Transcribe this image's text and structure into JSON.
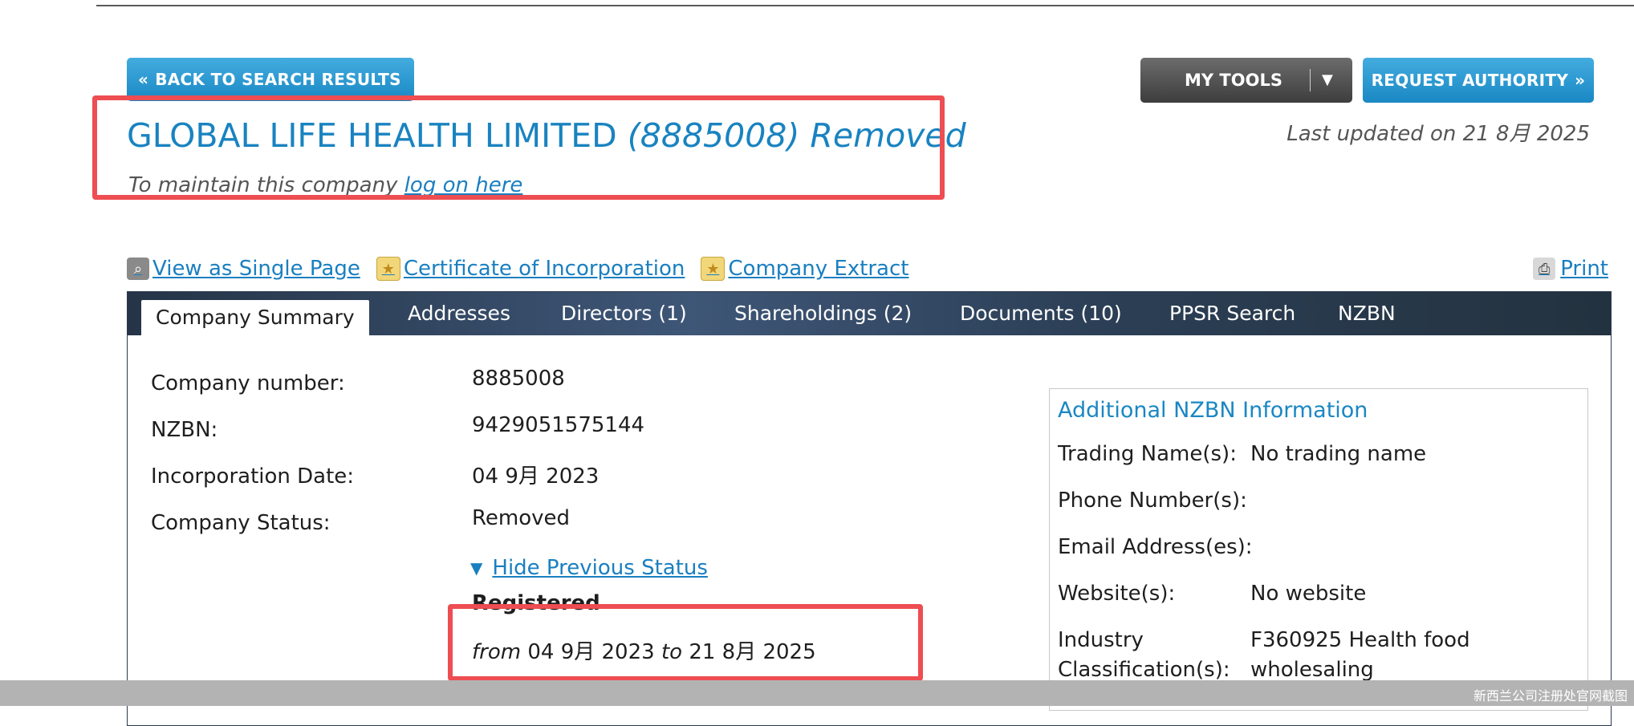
{
  "header": {
    "back_button": "BACK TO SEARCH RESULTS",
    "my_tools_button": "MY TOOLS",
    "request_authority_button": "REQUEST AUTHORITY",
    "last_updated": "Last updated on 21 8月 2025"
  },
  "company": {
    "name": "GLOBAL LIFE HEALTH LIMITED",
    "number_status": "(8885008) Removed",
    "maintain_text": "To maintain this company",
    "maintain_link": "log on here"
  },
  "tools": {
    "single_page": "View as Single Page",
    "certificate": "Certificate of Incorporation",
    "extract": "Company Extract",
    "print": "Print"
  },
  "tabs": [
    {
      "label": "Company Summary"
    },
    {
      "label": "Addresses"
    },
    {
      "label": "Directors (1)"
    },
    {
      "label": "Shareholdings (2)"
    },
    {
      "label": "Documents (10)"
    },
    {
      "label": "PPSR Search"
    },
    {
      "label": "NZBN"
    }
  ],
  "summary": {
    "company_number_label": "Company number:",
    "company_number": "8885008",
    "nzbn_label": "NZBN:",
    "nzbn": "9429051575144",
    "incorporation_label": "Incorporation Date:",
    "incorporation_date": "04 9月 2023",
    "status_label": "Company Status:",
    "status": "Removed",
    "hide_previous": "Hide Previous Status",
    "previous_status": "Registered",
    "range_from_word": "from",
    "range_from": "04 9月 2023",
    "range_to_word": "to",
    "range_to": "21 8月 2025"
  },
  "nzbn_info": {
    "title": "Additional NZBN Information",
    "trading_label": "Trading Name(s):",
    "trading_value": "No trading name",
    "phone_label": "Phone Number(s):",
    "email_label": "Email Address(es):",
    "website_label": "Website(s):",
    "website_value": "No website",
    "industry_label_1": "Industry",
    "industry_label_2": "Classification(s):",
    "industry_value_1": "F360925 Health food",
    "industry_value_2": "wholesaling"
  },
  "watermark": "新西兰公司注册处官网截图",
  "colors": {
    "accent_blue": "#1983c0",
    "highlight_red": "#ee4d52",
    "tabbar_dark": "#2c3f56"
  }
}
